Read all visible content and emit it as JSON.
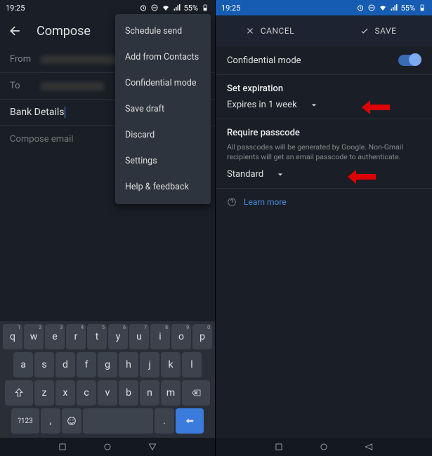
{
  "status": {
    "time": "19:25",
    "battery": "55%"
  },
  "compose": {
    "title": "Compose",
    "from_label": "From",
    "to_label": "To",
    "subject": "Bank Details",
    "body_placeholder": "Compose email"
  },
  "menu": {
    "items": [
      "Schedule send",
      "Add from Contacts",
      "Confidential mode",
      "Save draft",
      "Discard",
      "Settings",
      "Help & feedback"
    ]
  },
  "keyboard": {
    "row1": [
      "q",
      "w",
      "e",
      "r",
      "t",
      "y",
      "u",
      "i",
      "o",
      "p"
    ],
    "row1_sup": [
      "1",
      "2",
      "3",
      "4",
      "5",
      "6",
      "7",
      "8",
      "9",
      "0"
    ],
    "row2": [
      "a",
      "s",
      "d",
      "f",
      "g",
      "h",
      "j",
      "k",
      "l"
    ],
    "row3": [
      "z",
      "x",
      "c",
      "v",
      "b",
      "n",
      "m"
    ],
    "sym": "?123",
    "comma": ",",
    "period": "."
  },
  "confidential": {
    "cancel": "CANCEL",
    "save": "SAVE",
    "mode_label": "Confidential mode",
    "expiration_title": "Set expiration",
    "expiration_value": "Expires in 1 week",
    "passcode_title": "Require passcode",
    "passcode_desc": "All passcodes will be generated by Google. Non-Gmail recipients will get an email passcode to authenticate.",
    "passcode_value": "Standard",
    "learn_more": "Learn more"
  }
}
